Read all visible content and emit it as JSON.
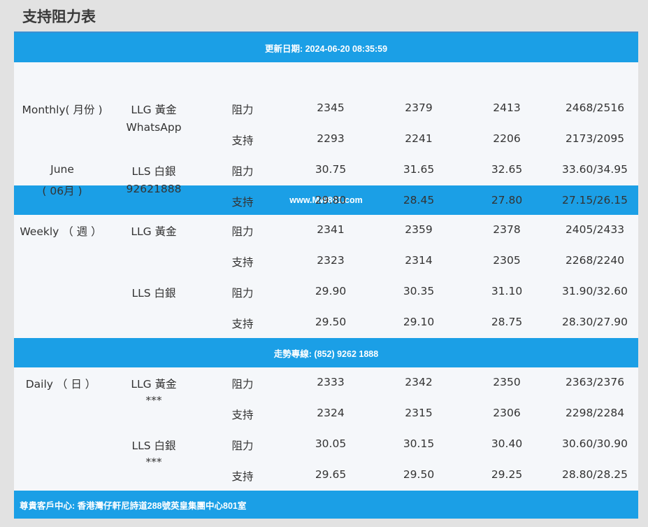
{
  "title": "支持阻力表",
  "update_bar": "更新日期: 2024-06-20 08:35:59",
  "website_bar": "www.MW801.com",
  "hotline_bar": "走勢專線: (852) 9262 1888",
  "footer_bar": "尊貴客戶中心: 香港灣仔軒尼詩道288號英皇集團中心801室",
  "monthly": {
    "period": "Monthly( 月份 )",
    "month_en": "June",
    "month_zh": "( 06月 )",
    "gold_name": "LLG 黃金",
    "gold_sub": "WhatsApp",
    "silver_name": "LLS 白銀",
    "silver_sub": "92621888",
    "rows": [
      {
        "type": "阻力",
        "v1": "2345",
        "v2": "2379",
        "v3": "2413",
        "v4": "2468/2516"
      },
      {
        "type": "支持",
        "v1": "2293",
        "v2": "2241",
        "v3": "2206",
        "v4": "2173/2095"
      },
      {
        "type": "阻力",
        "v1": "30.75",
        "v2": "31.65",
        "v3": "32.65",
        "v4": "33.60/34.95"
      },
      {
        "type": "支持",
        "v1": "29.80",
        "v2": "28.45",
        "v3": "27.80",
        "v4": "27.15/26.15"
      }
    ]
  },
  "weekly": {
    "period": "Weekly （ 週 ）",
    "gold_name": "LLG 黃金",
    "silver_name": "LLS 白銀",
    "rows": [
      {
        "type": "阻力",
        "v1": "2341",
        "v2": "2359",
        "v3": "2378",
        "v4": "2405/2433"
      },
      {
        "type": "支持",
        "v1": "2323",
        "v2": "2314",
        "v3": "2305",
        "v4": "2268/2240"
      },
      {
        "type": "阻力",
        "v1": "29.90",
        "v2": "30.35",
        "v3": "31.10",
        "v4": "31.90/32.60"
      },
      {
        "type": "支持",
        "v1": "29.50",
        "v2": "29.10",
        "v3": "28.75",
        "v4": "28.30/27.90"
      }
    ]
  },
  "daily": {
    "period": "Daily （ 日 ）",
    "gold_name": "LLG 黃金",
    "gold_sub": "***",
    "silver_name": "LLS 白銀",
    "silver_sub": "***",
    "rows": [
      {
        "type": "阻力",
        "v1": "2333",
        "v2": "2342",
        "v3": "2350",
        "v4": "2363/2376"
      },
      {
        "type": "支持",
        "v1": "2324",
        "v2": "2315",
        "v3": "2306",
        "v4": "2298/2284"
      },
      {
        "type": "阻力",
        "v1": "30.05",
        "v2": "30.15",
        "v3": "30.40",
        "v4": "30.60/30.90"
      },
      {
        "type": "支持",
        "v1": "29.65",
        "v2": "29.50",
        "v3": "29.25",
        "v4": "28.80/28.25"
      }
    ]
  }
}
